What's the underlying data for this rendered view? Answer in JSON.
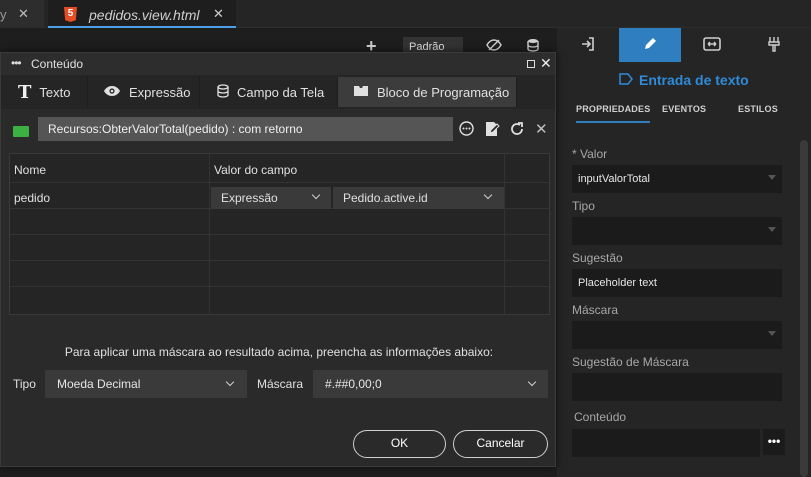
{
  "editor_tabs": {
    "prev_label": "y",
    "active_label": "pedidos.view.html",
    "html5_badge": "5"
  },
  "canvas_toolbar": {
    "profile_select": "Padrão"
  },
  "right_panel": {
    "component_title": "Entrada de texto",
    "tabs": [
      "PROPRIEDADES",
      "EVENTOS",
      "ESTILOS"
    ],
    "fields": {
      "valor_label": "* Valor",
      "valor_value": "inputValorTotal",
      "tipo_label": "Tipo",
      "tipo_value": "",
      "sugestao_label": "Sugestão",
      "sugestao_value": "Placeholder text",
      "mascara_label": "Máscara",
      "mascara_value": "",
      "sugestao_mascara_label": "Sugestão de Máscara",
      "sugestao_mascara_value": "",
      "conteudo_label": "Conteúdo",
      "conteudo_value": "",
      "more_button": "•••"
    }
  },
  "dialog": {
    "title": "Conteúdo",
    "tabs": [
      "Texto",
      "Expressão",
      "Campo da Tela",
      "Bloco de Programação"
    ],
    "active_tab": "Bloco de Programação",
    "expression": "Recursos:ObterValorTotal(pedido) : com retorno",
    "grid": {
      "headers": [
        "Nome",
        "Valor do campo"
      ],
      "rows": [
        {
          "name": "pedido",
          "type": "Expressão",
          "value": "Pedido.active.id"
        }
      ]
    },
    "mask_hint": "Para aplicar uma máscara ao resultado acima, preencha as informações abaixo:",
    "tipo_label": "Tipo",
    "tipo_value": "Moeda Decimal",
    "mascara_label": "Máscara",
    "mascara_value": "#.##0,00;0",
    "ok_label": "OK",
    "cancel_label": "Cancelar"
  },
  "colors": {
    "accent": "#2f7fc0",
    "accent_text": "#2f8bd8",
    "block_icon": "#3cb043",
    "html5": "#e44d26"
  }
}
